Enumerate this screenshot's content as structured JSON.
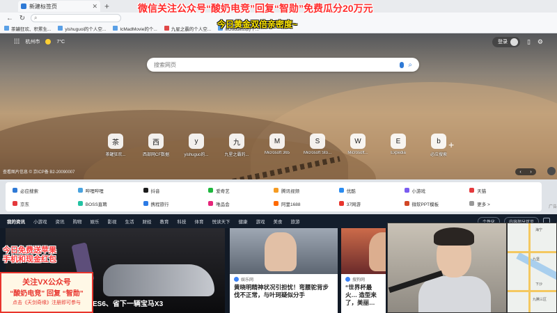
{
  "browser": {
    "tab_title": "新建标签页",
    "tab_close": "✕",
    "new_tab": "+",
    "back": "←",
    "refresh": "↻",
    "omnibox_text": "",
    "search_glyph": "⌕",
    "bookmarks": [
      "茶罐狂欢、积累生...",
      "yishuguoi的个人空...",
      "IcMadMovie的个...",
      "九星之霸的个人空...",
      "lllGoddess的个..."
    ]
  },
  "overlay": {
    "title": "微信关注公众号“酸奶电竞”回复“智勋”免费瓜分20万元",
    "subtitle": "今日黄金双倍亲密度~",
    "promo_red_line1": "今日免费送苹果",
    "promo_red_line2": "手机和现金红包",
    "promo_box_line1": "关注VX公众号",
    "promo_box_line2": "“酸奶电竞” 回复 “智勋”",
    "promo_box_line3": "点击《天剑奇缘》注册即可参与"
  },
  "hero": {
    "apps_icon": "⁞⁞⁞",
    "location": "杭州市",
    "temperature": "7°C",
    "login_label": "登录",
    "phone_icon": "▯",
    "settings_icon": "⚙",
    "search_placeholder": "搜索网页",
    "tiles": [
      {
        "label": "茶罐狂欢...",
        "icon": "茶"
      },
      {
        "label": "西部网CF数据",
        "icon": "西"
      },
      {
        "label": "yishuguo的...",
        "icon": "y"
      },
      {
        "label": "九星之霸的...",
        "icon": "九"
      },
      {
        "label": "Microsoft 365",
        "icon": "M"
      },
      {
        "label": "Microsoft Sto...",
        "icon": "S"
      },
      {
        "label": "Microsoft...",
        "icon": "W"
      },
      {
        "label": "Expedia",
        "icon": "E"
      },
      {
        "label": "必应搜索",
        "icon": "b"
      }
    ],
    "add_tile": "+",
    "credit": "查看图片信息 © 京ICP备 B2-20090007",
    "ctrl_prev": "‹",
    "ctrl_next": "›"
  },
  "quicklinks": [
    {
      "label": "必应搜索",
      "color": "#2f7ad6"
    },
    {
      "label": "哔哩哔哩",
      "color": "#4aa3df"
    },
    {
      "label": "抖音",
      "color": "#1c1c1c"
    },
    {
      "label": "爱奇艺",
      "color": "#1fb73e"
    },
    {
      "label": "腾讯视频",
      "color": "#f59b23"
    },
    {
      "label": "优酷",
      "color": "#2b8cf0"
    },
    {
      "label": "小游戏",
      "color": "#7a5cf0"
    },
    {
      "label": "天猫",
      "color": "#e4393c"
    },
    {
      "label": "京东",
      "color": "#e4393c"
    },
    {
      "label": "BOSS直聘",
      "color": "#23c2a3"
    },
    {
      "label": "携程旅行",
      "color": "#2c7be5"
    },
    {
      "label": "唯品会",
      "color": "#e6257a"
    },
    {
      "label": "阿里1688",
      "color": "#ff6a00"
    },
    {
      "label": "37网游",
      "color": "#e8352d"
    },
    {
      "label": "微软PPT模板",
      "color": "#d24726"
    },
    {
      "label": "更多 >",
      "color": "#999999"
    }
  ],
  "ad_label": "广告",
  "newsnav": {
    "items": [
      "我的资讯",
      "小游戏",
      "资讯",
      "购物",
      "娱乐",
      "影视",
      "生活",
      "财经",
      "教育",
      "科技",
      "体育",
      "悦读天下",
      "健康",
      "游戏",
      "美食",
      "旅游"
    ],
    "personalize": "个性化",
    "content_visible": "内容部分可见"
  },
  "news": {
    "big_caption": "ES6、省下一辆宝马X3",
    "cards": [
      {
        "source": "娱乐网",
        "headline": "黄晓明精神状况引担忧！弯腰驼背步伐不正常，与叶珂疑似分手"
      },
      {
        "source": "搜狗网",
        "headline": "“世界杯最火… 造型来了，美丽…"
      }
    ]
  },
  "map": {
    "labels": [
      "海宁",
      "九堡",
      "下沙",
      "九腾三区"
    ]
  }
}
